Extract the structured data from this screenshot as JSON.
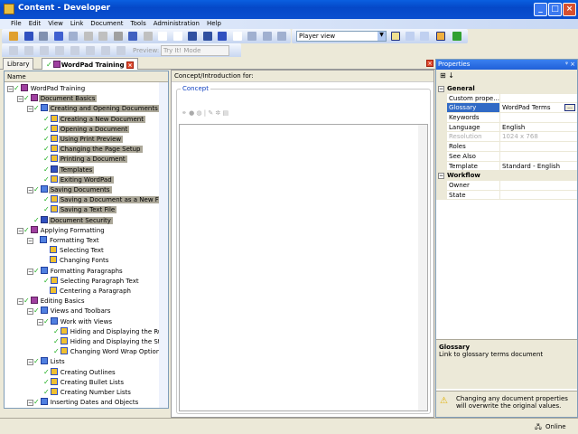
{
  "window": {
    "title": "Content - Developer"
  },
  "menu": [
    "File",
    "Edit",
    "View",
    "Link",
    "Document",
    "Tools",
    "Administration",
    "Help"
  ],
  "toolbar": {
    "view_select": "Player view",
    "preview_label": "Preview:",
    "preview_select": "Try It! Mode"
  },
  "tabs": [
    {
      "label": "Library"
    },
    {
      "label": "WordPad Training"
    }
  ],
  "outline": {
    "header": "Name",
    "rows": [
      {
        "label": "WordPad Training",
        "level": 0,
        "icon": "book",
        "check": true,
        "hl": false
      },
      {
        "label": "Document Basics",
        "level": 1,
        "icon": "book",
        "check": true,
        "hl": true
      },
      {
        "label": "Creating and Opening Documents",
        "level": 2,
        "icon": "module",
        "check": true,
        "hl": true
      },
      {
        "label": "Creating a New Document",
        "level": 3,
        "icon": "topic",
        "check": true,
        "hl": true
      },
      {
        "label": "Opening a Document",
        "level": 3,
        "icon": "topic",
        "check": true,
        "hl": true
      },
      {
        "label": "Using Print Preview",
        "level": 3,
        "icon": "topic",
        "check": true,
        "hl": true
      },
      {
        "label": "Changing the Page Setup",
        "level": 3,
        "icon": "topic",
        "check": true,
        "hl": true
      },
      {
        "label": "Printing a Document",
        "level": 3,
        "icon": "topic",
        "check": true,
        "hl": true
      },
      {
        "label": "Templates",
        "level": 3,
        "icon": "document",
        "check": true,
        "hl": true
      },
      {
        "label": "Exiting WordPad",
        "level": 3,
        "icon": "topic",
        "check": true,
        "hl": true
      },
      {
        "label": "Saving Documents",
        "level": 2,
        "icon": "module",
        "check": true,
        "hl": true
      },
      {
        "label": "Saving a Document as a New File",
        "level": 3,
        "icon": "topic",
        "check": true,
        "hl": true
      },
      {
        "label": "Saving a Text File",
        "level": 3,
        "icon": "topic",
        "check": true,
        "hl": true
      },
      {
        "label": "Document Security",
        "level": 2,
        "icon": "document",
        "check": true,
        "hl": true
      },
      {
        "label": "Applying Formatting",
        "level": 1,
        "icon": "book",
        "check": true,
        "hl": false
      },
      {
        "label": "Formatting Text",
        "level": 2,
        "icon": "module",
        "check": false,
        "hl": false
      },
      {
        "label": "Selecting Text",
        "level": 3,
        "icon": "topic",
        "check": false,
        "hl": false
      },
      {
        "label": "Changing Fonts",
        "level": 3,
        "icon": "topic",
        "check": false,
        "hl": false
      },
      {
        "label": "Formatting Paragraphs",
        "level": 2,
        "icon": "module",
        "check": true,
        "hl": false
      },
      {
        "label": "Selecting Paragraph Text",
        "level": 3,
        "icon": "topic",
        "check": true,
        "hl": false
      },
      {
        "label": "Centering a Paragraph",
        "level": 3,
        "icon": "topic",
        "check": false,
        "hl": false
      },
      {
        "label": "Editing Basics",
        "level": 1,
        "icon": "book",
        "check": true,
        "hl": false
      },
      {
        "label": "Views and Toolbars",
        "level": 2,
        "icon": "module",
        "check": true,
        "hl": false
      },
      {
        "label": "Work with Views",
        "level": 3,
        "icon": "module",
        "check": true,
        "hl": false
      },
      {
        "label": "Hiding and Displaying the Ruler",
        "level": 4,
        "icon": "topic",
        "check": true,
        "hl": false
      },
      {
        "label": "Hiding and Displaying the Status",
        "level": 4,
        "icon": "topic",
        "check": true,
        "hl": false
      },
      {
        "label": "Changing Word Wrap Options",
        "level": 4,
        "icon": "topic",
        "check": true,
        "hl": false
      },
      {
        "label": "Lists",
        "level": 2,
        "icon": "module",
        "check": true,
        "hl": false
      },
      {
        "label": "Creating Outlines",
        "level": 3,
        "icon": "topic",
        "check": true,
        "hl": false
      },
      {
        "label": "Creating Bullet Lists",
        "level": 3,
        "icon": "topic",
        "check": true,
        "hl": false
      },
      {
        "label": "Creating Number Lists",
        "level": 3,
        "icon": "topic",
        "check": true,
        "hl": false
      },
      {
        "label": "Inserting Dates and Objects",
        "level": 2,
        "icon": "module",
        "check": true,
        "hl": false
      }
    ]
  },
  "center": {
    "header": "Concept/Introduction for:",
    "group": "Concept"
  },
  "properties": {
    "title": "Properties",
    "categories": [
      {
        "name": "General",
        "rows": [
          {
            "k": "Custom prope...",
            "v": ""
          },
          {
            "k": "Glossary",
            "v": "WordPad Terms",
            "selected": true
          },
          {
            "k": "Keywords",
            "v": ""
          },
          {
            "k": "Language",
            "v": "English"
          },
          {
            "k": "Resolution",
            "v": "1024 x 768",
            "disabled": true
          },
          {
            "k": "Roles",
            "v": ""
          },
          {
            "k": "See Also",
            "v": ""
          },
          {
            "k": "Template",
            "v": "Standard - English"
          }
        ]
      },
      {
        "name": "Workflow",
        "rows": [
          {
            "k": "Owner",
            "v": ""
          },
          {
            "k": "State",
            "v": ""
          }
        ]
      }
    ],
    "desc_title": "Glossary",
    "desc_text": "Link to glossary terms document",
    "warning": "Changing any document properties will overwrite the original values."
  },
  "status": {
    "text": "Online"
  }
}
